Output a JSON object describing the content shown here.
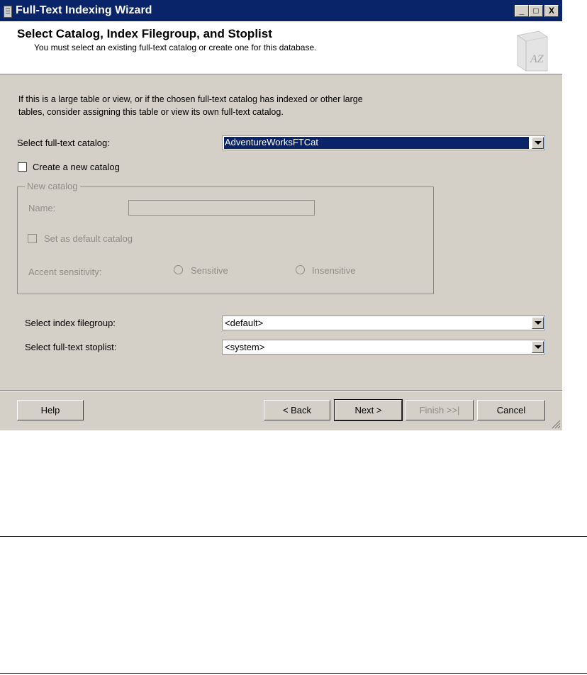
{
  "window": {
    "title": "Full-Text Indexing Wizard",
    "minimize": "_",
    "maximize": "□",
    "close": "X"
  },
  "header": {
    "title": "Select Catalog, Index Filegroup, and Stoplist",
    "subtitle": "You must select an existing full-text catalog or create one for this database.",
    "icon_text": "AZ"
  },
  "intro": {
    "line1": "If this is a large table or view, or if the chosen full-text catalog has indexed or other large",
    "line2": "tables, consider assigning this table or view its own full-text catalog."
  },
  "catalog": {
    "label": "Select full-text catalog:",
    "value": "AdventureWorksFTCat"
  },
  "create_new": {
    "label": "Create a new catalog",
    "checked": false
  },
  "new_catalog": {
    "group_label": "New catalog",
    "name_label": "Name:",
    "name_value": "",
    "default_label": "Set as default catalog",
    "accent_label": "Accent sensitivity:",
    "sensitive_label": "Sensitive",
    "insensitive_label": "Insensitive"
  },
  "filegroup": {
    "label": "Select index filegroup:",
    "value": "<default>"
  },
  "stoplist": {
    "label": "Select full-text stoplist:",
    "value": "<system>"
  },
  "buttons": {
    "help": "Help",
    "back": "< Back",
    "next": "Next >",
    "finish": "Finish >>|",
    "cancel": "Cancel"
  },
  "colors": {
    "titlebar": "#0a246a",
    "dialog_bg": "#d4d0c8",
    "selection": "#0a246a"
  }
}
